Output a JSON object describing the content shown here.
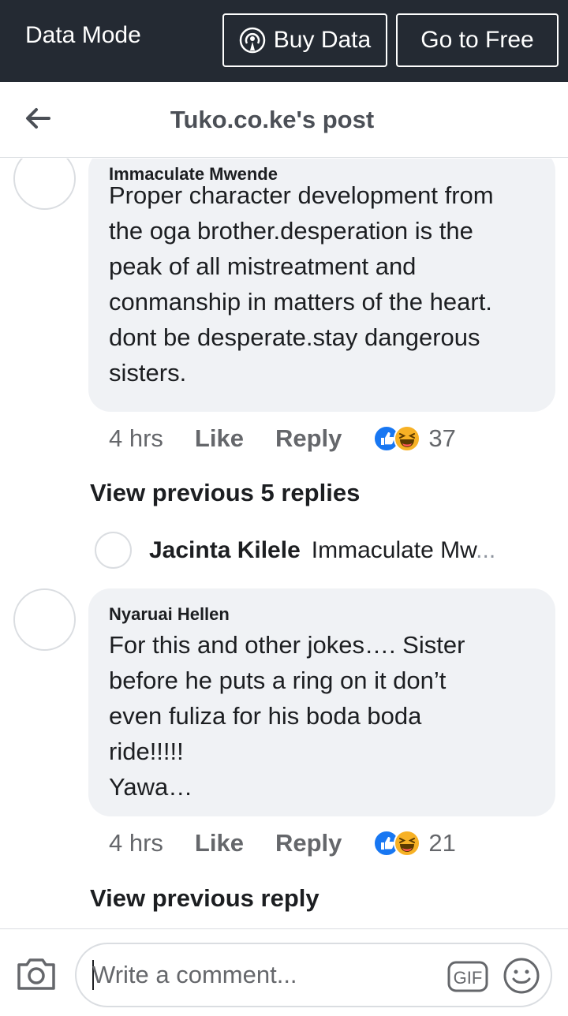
{
  "topbar": {
    "mode_label": "Data Mode",
    "buy_label": "Buy Data",
    "free_label": "Go to Free"
  },
  "header": {
    "title": "Tuko.co.ke's post"
  },
  "comments": [
    {
      "author": "Immaculate Mwende",
      "text": "Proper character development from\nthe oga brother.desperation is the\npeak of all mistreatment and\nconmanship in matters of the heart.\ndont be desperate.stay dangerous\nsisters.",
      "time": "4 hrs",
      "like_label": "Like",
      "reply_label": "Reply",
      "reaction_count": "37",
      "reactions": [
        "like-icon",
        "haha-icon"
      ],
      "view_previous": "View previous 5 replies",
      "latest_reply": {
        "name": "Jacinta Kilele",
        "text": "Immaculate Mw",
        "ellipsis": "..."
      }
    },
    {
      "author": "Nyaruai Hellen",
      "text": "For this and other jokes….      Sister\nbefore he puts a ring on it don’t\neven fuliza for  his boda boda\nride!!!!!\nYawa…",
      "time": "4 hrs",
      "like_label": "Like",
      "reply_label": "Reply",
      "reaction_count": "21",
      "reactions": [
        "like-icon",
        "haha-icon"
      ],
      "view_previous": "View previous reply"
    }
  ],
  "composer": {
    "placeholder": "Write a comment...",
    "gif_label": "GIF"
  },
  "colors": {
    "topbar_bg": "#242a33",
    "bubble_bg": "#f0f2f5",
    "like_blue": "#1877f2",
    "haha_yellow": "#f7b125"
  }
}
